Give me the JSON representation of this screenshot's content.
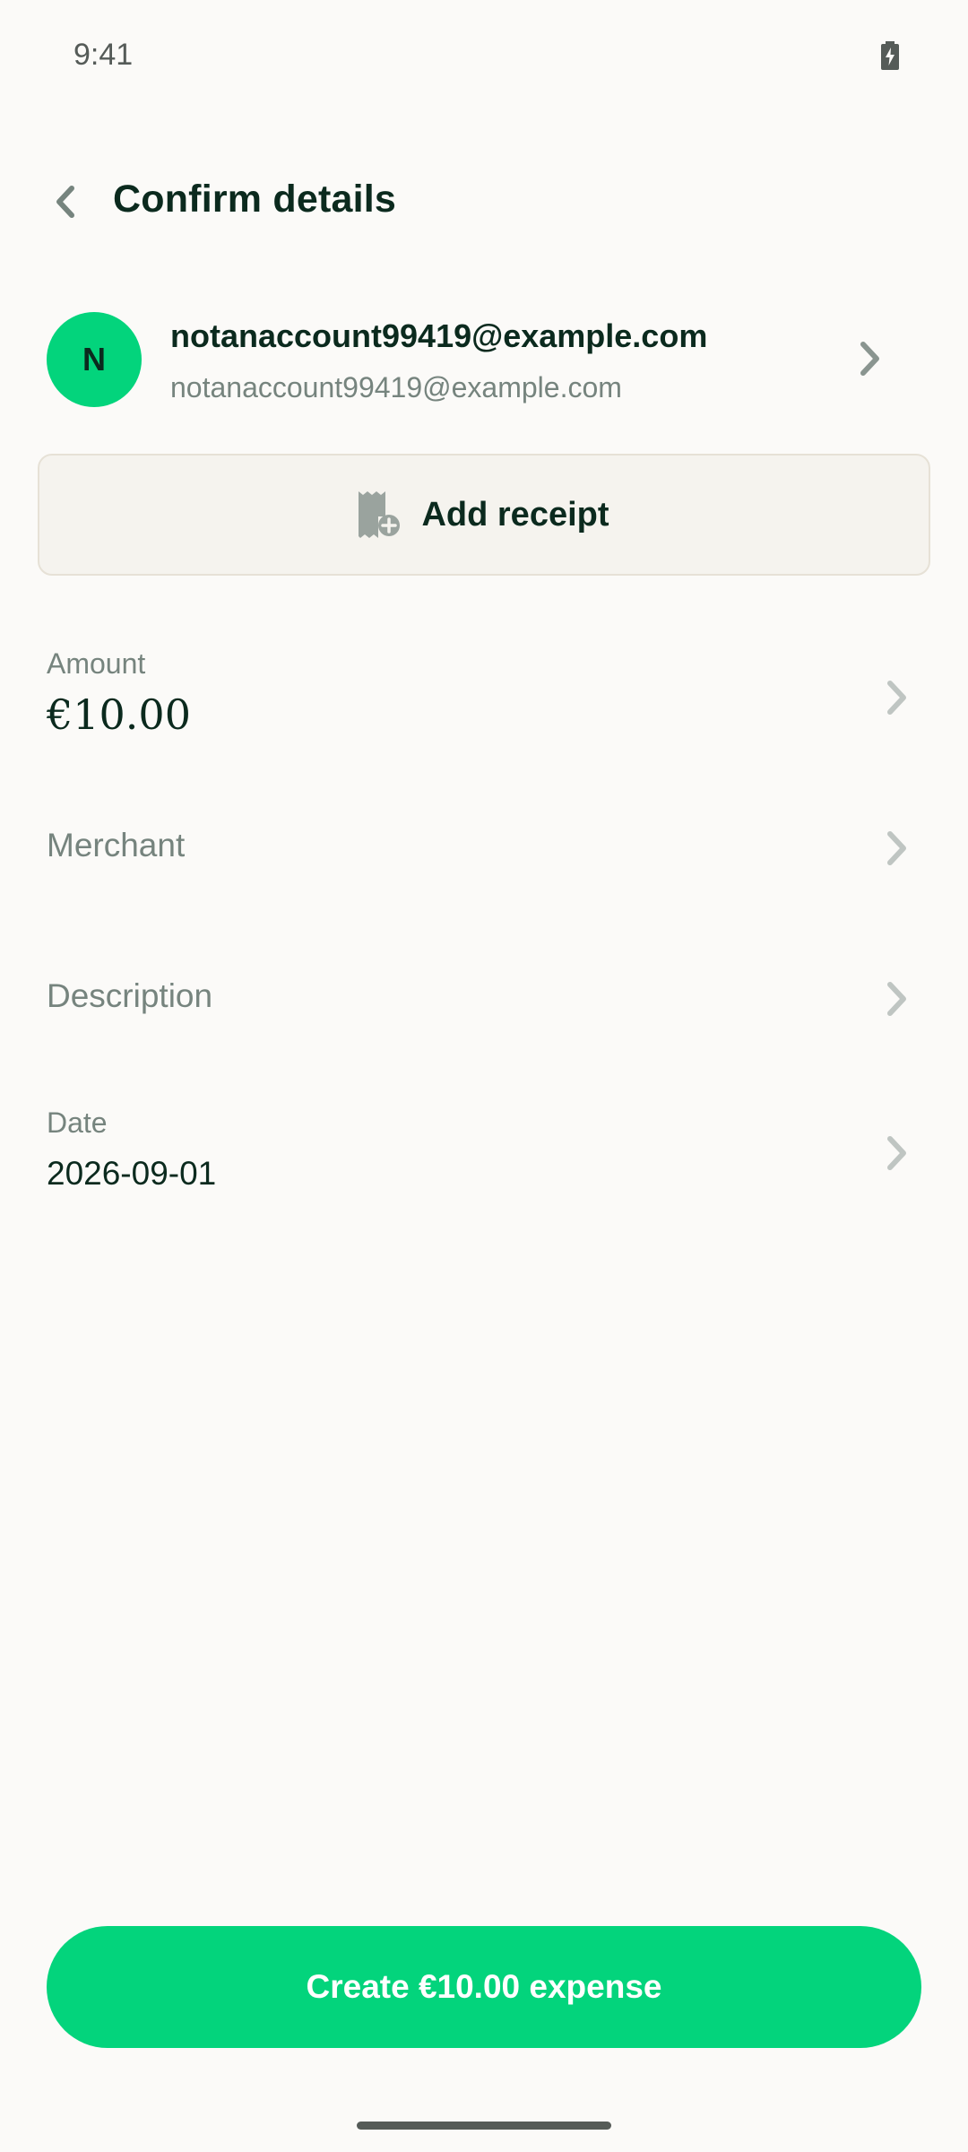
{
  "status_bar": {
    "time": "9:41"
  },
  "header": {
    "title": "Confirm details"
  },
  "recipient": {
    "avatar_initial": "N",
    "name": "notanaccount99419@example.com",
    "email": "notanaccount99419@example.com"
  },
  "add_receipt": {
    "label": "Add receipt"
  },
  "fields": {
    "amount": {
      "label": "Amount",
      "value": "€10.00"
    },
    "merchant": {
      "label": "Merchant"
    },
    "description": {
      "label": "Description"
    },
    "date": {
      "label": "Date",
      "value": "2026-09-01"
    }
  },
  "create_button": {
    "label": "Create €10.00 expense"
  },
  "colors": {
    "accent": "#03D47C",
    "text_primary": "#0B2A1E",
    "text_secondary": "#76847E",
    "background": "#FBFAF8",
    "chevron": "#BFC5C2"
  },
  "icons": {
    "back": "chevron-left-icon",
    "battery": "battery-charging-icon",
    "receipt": "receipt-plus-icon",
    "row_chevron": "chevron-right-icon"
  }
}
